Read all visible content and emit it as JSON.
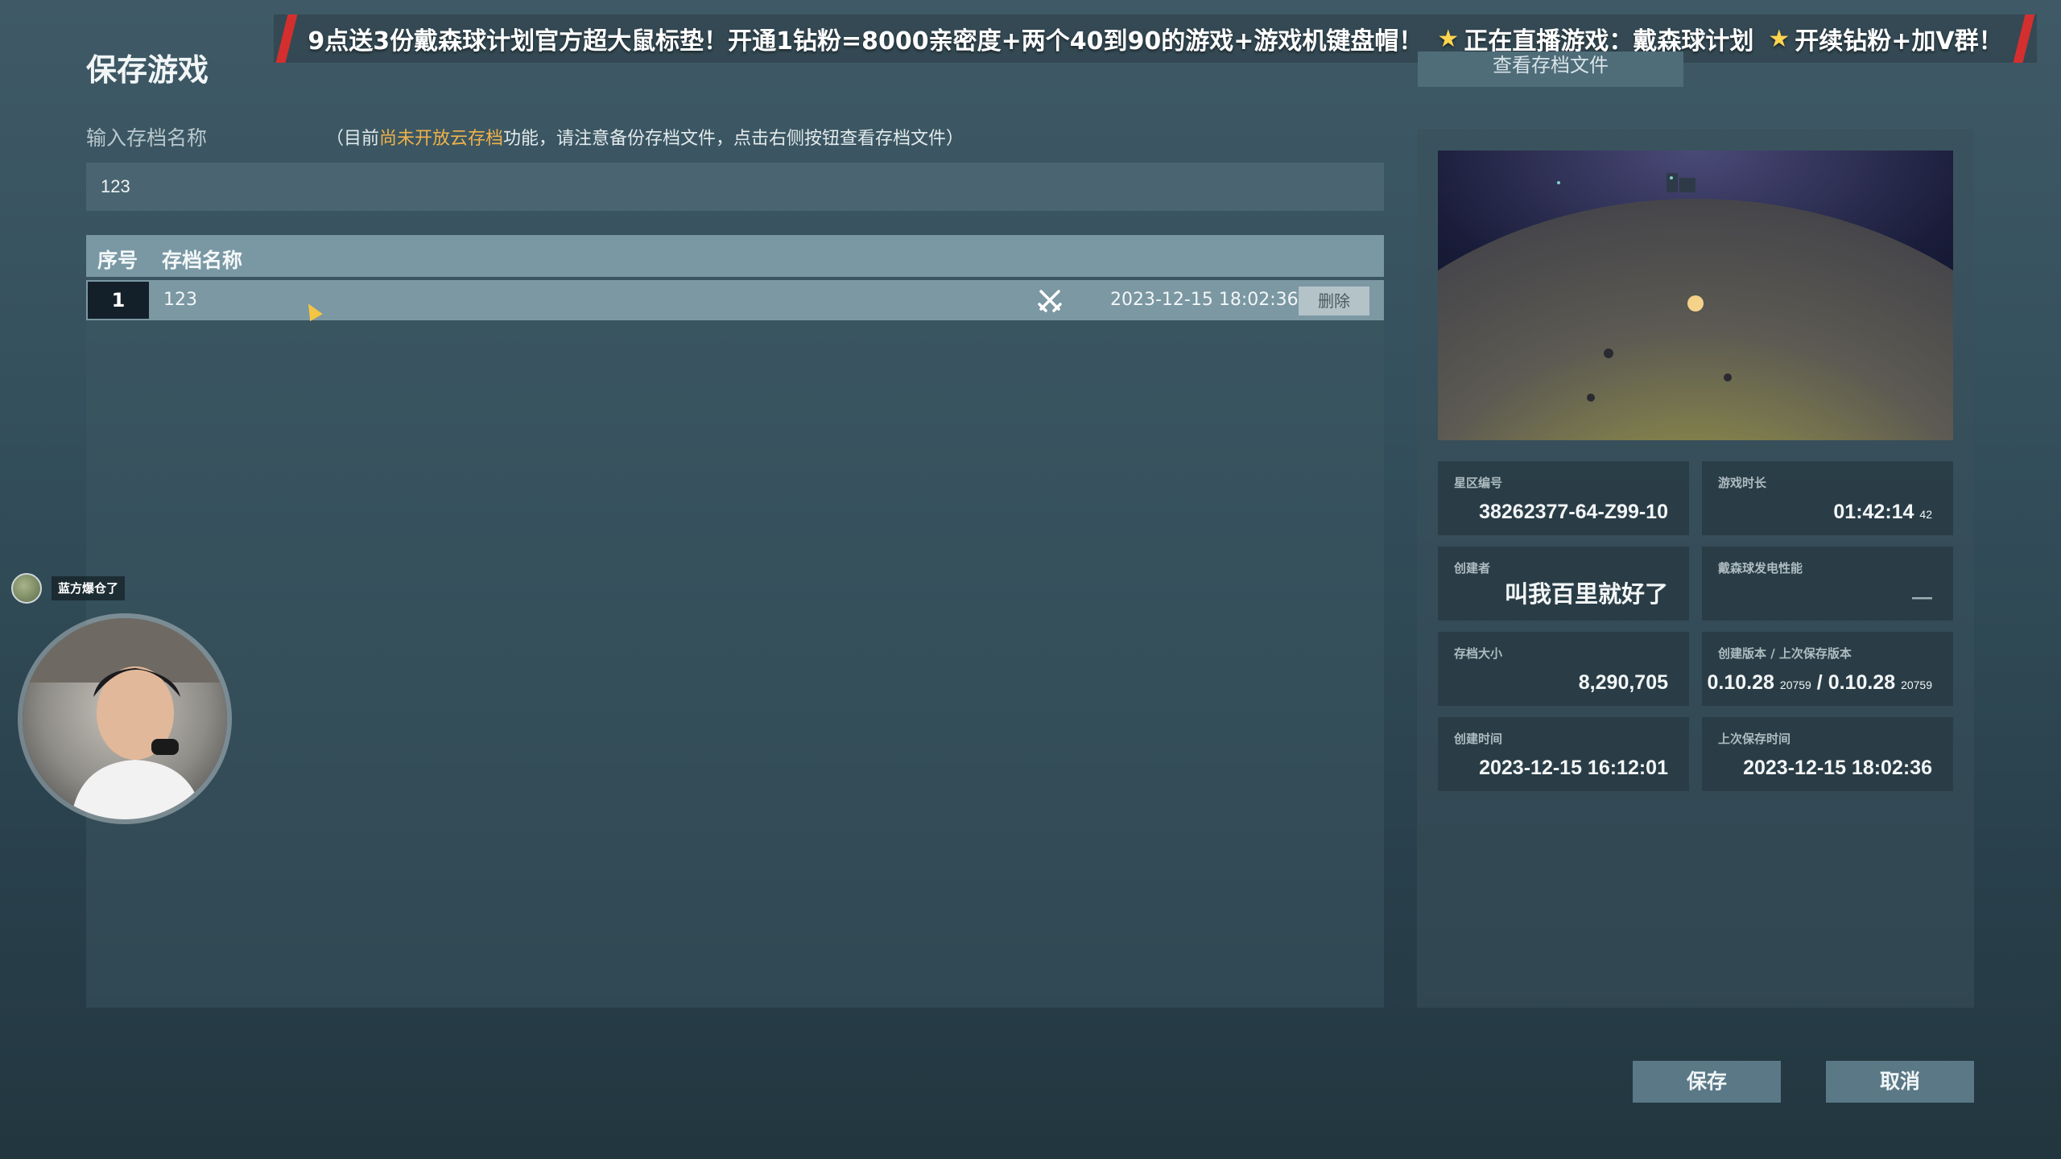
{
  "page": {
    "title": "保存游戏"
  },
  "banner": {
    "promo": "9点送3份戴森球计划官方超大鼠标垫！开通1钻粉=8000亲密度+两个40到90的游戏+游戏机键盘帽！",
    "live": "正在直播游戏：戴森球计划",
    "join": "开续钻粉+加V群！"
  },
  "view_files_button": "查看存档文件",
  "input": {
    "label": "输入存档名称",
    "note_prefix": "（目前",
    "note_highlight": "尚未开放云存档",
    "note_suffix": "功能，请注意备份存档文件，点击右侧按钮查看存档文件）",
    "value": "123"
  },
  "table": {
    "headers": {
      "index": "序号",
      "name": "存档名称"
    },
    "rows": [
      {
        "index": "1",
        "name": "123",
        "mode_icon": "crossed-swords-icon",
        "time": "2023-12-15 18:02:36",
        "delete": "删除"
      }
    ]
  },
  "details": {
    "cluster_label": "星区编号",
    "cluster_value": "38262377-64-Z99-10",
    "playtime_label": "游戏时长",
    "playtime_value": "01:42:14",
    "playtime_sub": "42",
    "creator_label": "创建者",
    "creator_value": "叫我百里就好了",
    "dyson_label": "戴森球发电性能",
    "dyson_value": "—",
    "size_label": "存档大小",
    "size_value": "8,290,705",
    "version_label": "创建版本 / 上次保存版本",
    "version_create": "0.10.28",
    "version_create_build": "20759",
    "version_sep": " / ",
    "version_save": "0.10.28",
    "version_save_build": "20759",
    "created_label": "创建时间",
    "created_value": "2023-12-15  16:12:01",
    "saved_label": "上次保存时间",
    "saved_value": "2023-12-15  18:02:36"
  },
  "buttons": {
    "save": "保存",
    "cancel": "取消"
  },
  "overlay": {
    "chat_name": "蓝方爆仓了"
  }
}
